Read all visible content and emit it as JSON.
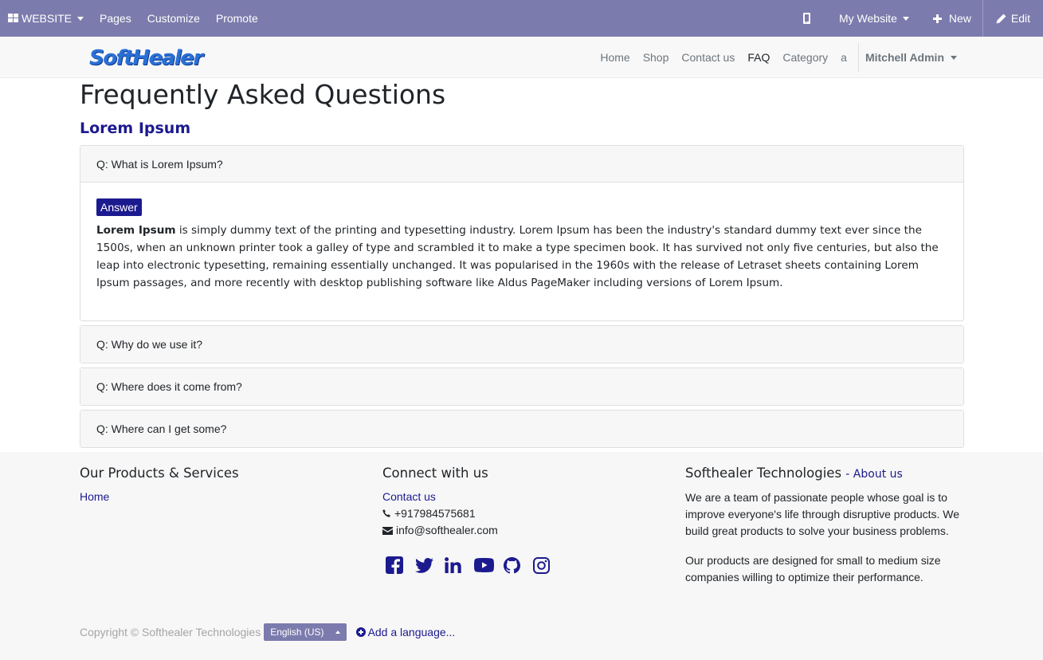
{
  "adminbar": {
    "website_label": "WEBSITE",
    "menu": [
      "Pages",
      "Customize",
      "Promote"
    ],
    "my_website_label": "My Website",
    "new_label": "New",
    "edit_label": "Edit"
  },
  "navbar": {
    "logo_text": "SoftHealer",
    "links": [
      "Home",
      "Shop",
      "Contact us",
      "FAQ",
      "Category",
      "a"
    ],
    "active_link": "FAQ",
    "user_name": "Mitchell Admin"
  },
  "page": {
    "title": "Frequently Asked Questions",
    "section_title": "Lorem Ipsum",
    "faqs": [
      {
        "question": "Q: What is Lorem Ipsum?",
        "expanded": true,
        "answer_badge": "Answer",
        "answer_bold": "Lorem Ipsum",
        "answer_text": " is simply dummy text of the printing and typesetting industry. Lorem Ipsum has been the industry's standard dummy text ever since the 1500s, when an unknown printer took a galley of type and scrambled it to make a type specimen book. It has survived not only five centuries, but also the leap into electronic typesetting, remaining essentially unchanged. It was popularised in the 1960s with the release of Letraset sheets containing Lorem Ipsum passages, and more recently with desktop publishing software like Aldus PageMaker including versions of Lorem Ipsum."
      },
      {
        "question": "Q: Why do we use it?",
        "expanded": false
      },
      {
        "question": "Q: Where does it come from?",
        "expanded": false
      },
      {
        "question": "Q: Where can I get some?",
        "expanded": false
      }
    ]
  },
  "footer": {
    "products": {
      "heading": "Our Products & Services",
      "home_link": "Home"
    },
    "connect": {
      "heading": "Connect with us",
      "contact_link": "Contact us",
      "phone": "+917984575681",
      "email": "info@softhealer.com",
      "social_icons": [
        "facebook-icon",
        "twitter-icon",
        "linkedin-icon",
        "youtube-icon",
        "github-icon",
        "instagram-icon"
      ]
    },
    "company": {
      "heading": "Softhealer Technologies",
      "about_link": "- About us",
      "para1": "We are a team of passionate people whose goal is to improve everyone's life through disruptive products. We build great products to solve your business problems.",
      "para2": "Our products are designed for small to medium size companies willing to optimize their performance."
    },
    "copyright": "Copyright © Softhealer Technologies",
    "language": "English (US)",
    "add_language": "Add a language..."
  },
  "colors": {
    "admin_bar": "#7c7bad",
    "primary": "#1c1a8f",
    "navbar_bg": "#f8f8f8",
    "footer_bg": "#f7f7f7"
  }
}
